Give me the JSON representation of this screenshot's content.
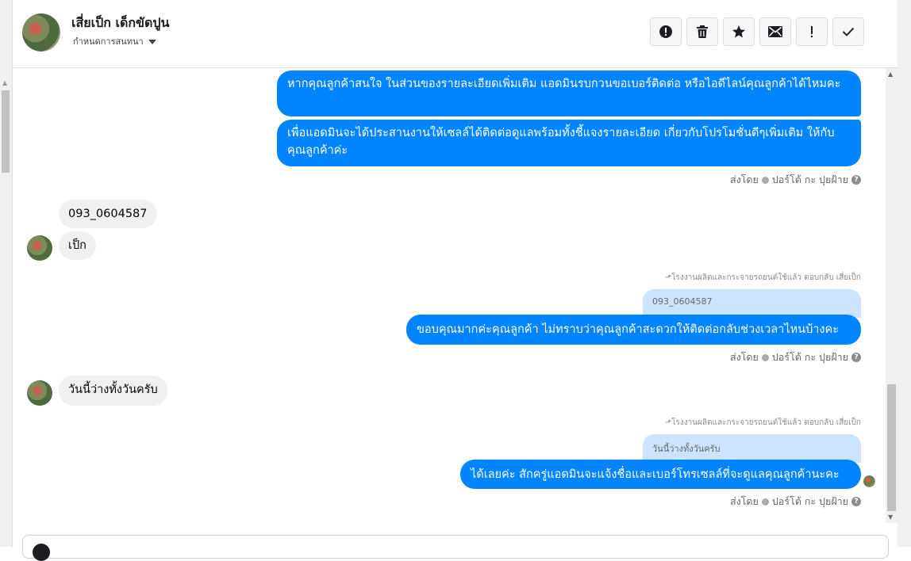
{
  "header": {
    "contact_name": "เสี่ยเป็ก เด็กขัดปูน",
    "subtitle": "กำหนดการสนทนา",
    "tools": [
      {
        "name": "report-icon",
        "label": "report"
      },
      {
        "name": "trash-icon",
        "label": "delete"
      },
      {
        "name": "star-icon",
        "label": "star"
      },
      {
        "name": "mail-icon",
        "label": "unread"
      },
      {
        "name": "exclamation-icon",
        "label": "spam"
      },
      {
        "name": "check-icon",
        "label": "done"
      }
    ]
  },
  "messages": {
    "out1": "หากคุณลูกค้าสนใจ ในส่วนของรายละเอียดเพิ่มเติม แอดมินรบกวนขอเบอร์ติดต่อ หรือไอดีไลน์คุณลูกค้าได้ไหมคะ",
    "out2": "เพื่อแอดมินจะได้ประสานงานให้เซลล์ได้ติดต่อดูแลพร้อมทั้งชี้แจงรายละเอียด เกี่ยวกับโปรโมชั่นดีๆเพิ่มเติม ให้กับคุณลูกค้าค่ะ",
    "sent_by_1": "ส่งโดย",
    "agent_1": "ปอร์โต้ กะ ปุยฝ้าย",
    "in1": "093_0604587",
    "in2": "เป็ก",
    "reply_note_1": "โรงงานผลิตและกระจายรถยนต์ใช้แล้ว ตอบกลับ เสี่ยเป็ก",
    "quote_1": "093_0604587",
    "out3": "ขอบคุณมากค่ะคุณลูกค้า ไม่ทราบว่าคุณลูกค้าสะดวกให้ติดต่อกลับช่วงเวลาไหนบ้างคะ",
    "sent_by_2": "ส่งโดย",
    "agent_2": "ปอร์โต้ กะ ปุยฝ้าย",
    "in3": "วันนี้ว่างทั้งวันครับ",
    "reply_note_2": "โรงงานผลิตและกระจายรถยนต์ใช้แล้ว ตอบกลับ เสี่ยเป็ก",
    "quote_2": "วันนี้ว่างทั้งวันครับ",
    "out4": "ได้เลยค่ะ สักครู่แอดมินจะแจ้งชื่อและเบอร์โทรเซลล์ที่จะดูแลคุณลูกค้านะคะ",
    "sent_by_3": "ส่งโดย",
    "agent_3": "ปอร์โต้ กะ ปุยฝ้าย"
  },
  "colors": {
    "outgoing_bubble": "#0084ff",
    "incoming_bubble": "#f0f0f0",
    "quote_bubble": "#cce4ff"
  }
}
